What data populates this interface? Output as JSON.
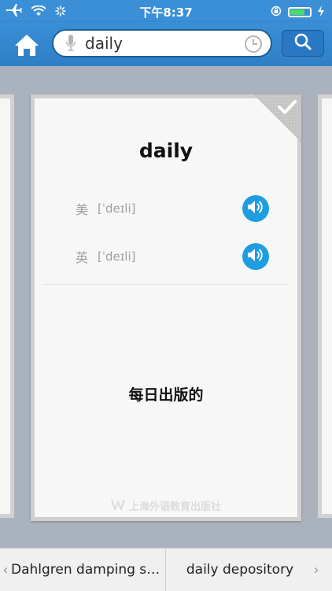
{
  "status": {
    "time": "下午8:37"
  },
  "search": {
    "value": "daily"
  },
  "card": {
    "word": "daily",
    "pronunciations": [
      {
        "label": "美",
        "phonetic": "[ˈdeɪli]"
      },
      {
        "label": "英",
        "phonetic": "[ˈdeɪli]"
      }
    ],
    "meaning": "每日出版的",
    "publisher": "上海外语教育出版社"
  },
  "nav": {
    "prev_label": "Dahlgren damping sy...",
    "next_label": "daily depository",
    "prev_arrow": "‹",
    "next_arrow": "›"
  },
  "icons": [
    "airplane-icon",
    "wifi-icon",
    "activity-icon",
    "lock-rotation-icon",
    "battery-icon",
    "charging-icon",
    "home-icon",
    "mic-icon",
    "clock-icon",
    "search-icon",
    "check-icon",
    "speaker-icon",
    "publisher-logo-icon"
  ],
  "colors": {
    "header": "#3a8fd6",
    "speaker": "#1e9ee0",
    "battery": "#4cd964"
  }
}
